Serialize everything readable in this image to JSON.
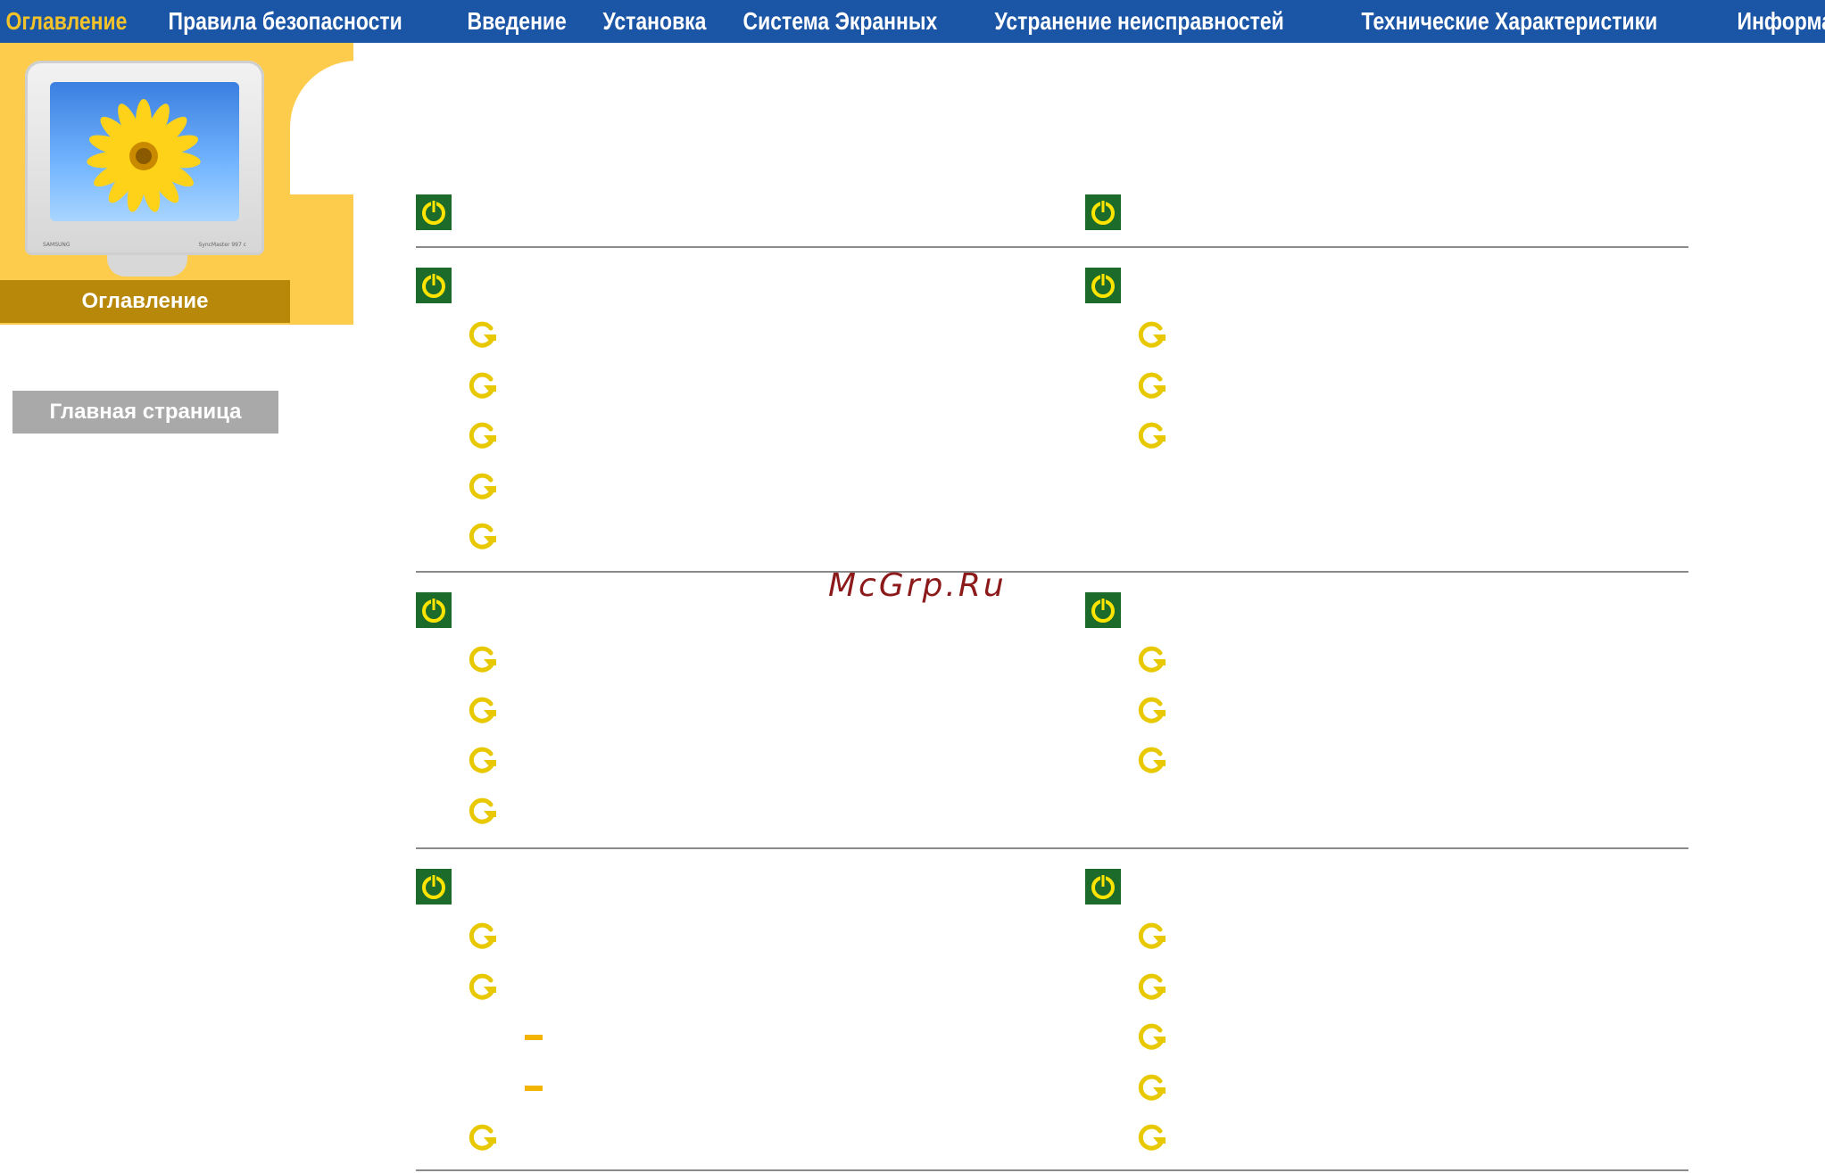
{
  "nav": {
    "items": [
      {
        "label": "Оглавление",
        "active": true
      },
      {
        "label": "Правила безопасности",
        "active": false
      },
      {
        "label": "Введение",
        "active": false
      },
      {
        "label": "Установка",
        "active": false
      },
      {
        "label": "Система Экранных",
        "active": false
      },
      {
        "label": "Устранение неисправностей",
        "active": false
      },
      {
        "label": "Технические Характеристики",
        "active": false
      },
      {
        "label": "Информации",
        "active": false
      }
    ]
  },
  "sidebar": {
    "monitor_brand": "SAMSUNG",
    "monitor_model": "SyncMaster 997 c",
    "section_title": "Оглавление",
    "home_button": "Главная страница"
  },
  "watermark": "McGrp.Ru",
  "colors": {
    "nav_bg": "#1b55a6",
    "nav_active": "#f2c22b",
    "sidebar_yellow": "#fecc4d",
    "banner_gold": "#b8880a",
    "home_button_gray": "#a9a9a9",
    "section_icon_green": "#1c6b2a",
    "bullet_yellow": "#f2d400",
    "dash_orange": "#f2b400"
  },
  "icons": {
    "section": "power-icon",
    "item": "refresh-arrow-icon",
    "subitem": "dash-icon"
  },
  "sections": [
    {
      "col": "left",
      "row": 0,
      "title": "",
      "items": []
    },
    {
      "col": "right",
      "row": 0,
      "title": "",
      "items": []
    },
    {
      "col": "left",
      "row": 1,
      "title": "",
      "items": [
        "",
        "",
        "",
        "",
        ""
      ]
    },
    {
      "col": "right",
      "row": 1,
      "title": "",
      "items": [
        "",
        "",
        ""
      ]
    },
    {
      "col": "left",
      "row": 2,
      "title": "",
      "items": [
        "",
        "",
        "",
        ""
      ]
    },
    {
      "col": "right",
      "row": 2,
      "title": "",
      "items": [
        "",
        "",
        ""
      ]
    },
    {
      "col": "left",
      "row": 3,
      "title": "",
      "items": [
        "",
        "",
        "",
        "",
        ""
      ]
    },
    {
      "col": "right",
      "row": 3,
      "title": "",
      "items": [
        "",
        "",
        "",
        "",
        ""
      ]
    }
  ]
}
